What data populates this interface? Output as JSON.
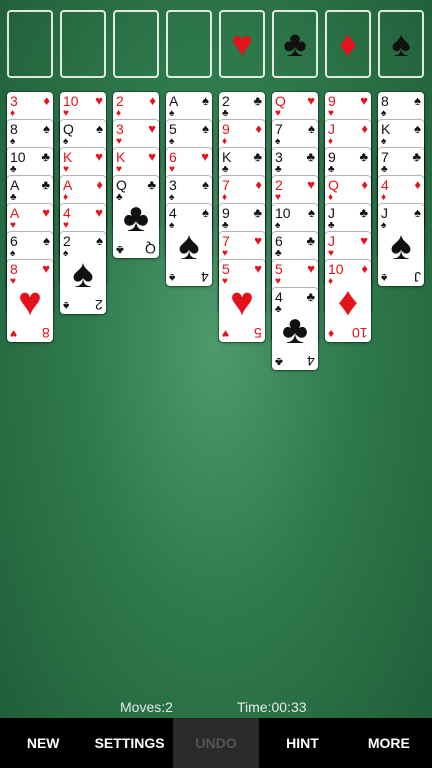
{
  "foundations": [
    {
      "suit": "",
      "color": "black"
    },
    {
      "suit": "",
      "color": "black"
    },
    {
      "suit": "",
      "color": "black"
    },
    {
      "suit": "",
      "color": "black"
    },
    {
      "suit": "♥",
      "color": "red"
    },
    {
      "suit": "♣",
      "color": "black"
    },
    {
      "suit": "♦",
      "color": "red"
    },
    {
      "suit": "♠",
      "color": "black"
    }
  ],
  "columns": [
    [
      [
        "3",
        "♦"
      ],
      [
        "8",
        "♠"
      ],
      [
        "10",
        "♣"
      ],
      [
        "A",
        "♣"
      ],
      [
        "A",
        "♥"
      ],
      [
        "6",
        "♠"
      ],
      [
        "8",
        "♥"
      ]
    ],
    [
      [
        "10",
        "♥"
      ],
      [
        "Q",
        "♠"
      ],
      [
        "K",
        "♥"
      ],
      [
        "A",
        "♦"
      ],
      [
        "4",
        "♥"
      ],
      [
        "2",
        "♠"
      ]
    ],
    [
      [
        "2",
        "♦"
      ],
      [
        "3",
        "♥"
      ],
      [
        "K",
        "♥"
      ],
      [
        "Q",
        "♣"
      ]
    ],
    [
      [
        "A",
        "♠"
      ],
      [
        "5",
        "♠"
      ],
      [
        "6",
        "♥"
      ],
      [
        "3",
        "♠"
      ],
      [
        "4",
        "♠"
      ]
    ],
    [
      [
        "2",
        "♣"
      ],
      [
        "9",
        "♦"
      ],
      [
        "K",
        "♣"
      ],
      [
        "7",
        "♦"
      ],
      [
        "9",
        "♣"
      ],
      [
        "7",
        "♥"
      ],
      [
        "5",
        "♥"
      ]
    ],
    [
      [
        "Q",
        "♥"
      ],
      [
        "7",
        "♠"
      ],
      [
        "3",
        "♣"
      ],
      [
        "2",
        "♥"
      ],
      [
        "10",
        "♠"
      ],
      [
        "6",
        "♣"
      ],
      [
        "5",
        "♥"
      ],
      [
        "4",
        "♣"
      ]
    ],
    [
      [
        "9",
        "♥"
      ],
      [
        "J",
        "♦"
      ],
      [
        "9",
        "♣"
      ],
      [
        "Q",
        "♦"
      ],
      [
        "J",
        "♣"
      ],
      [
        "J",
        "♥"
      ],
      [
        "10",
        "♦"
      ]
    ],
    [
      [
        "8",
        "♠"
      ],
      [
        "K",
        "♠"
      ],
      [
        "7",
        "♣"
      ],
      [
        "4",
        "♦"
      ],
      [
        "J",
        "♠"
      ]
    ]
  ],
  "status": {
    "moves_label": "Moves:",
    "moves": "2",
    "time_label": "Time:",
    "time": "00:33"
  },
  "toolbar": {
    "new": "NEW",
    "settings": "SETTINGS",
    "undo": "UNDO",
    "hint": "HINT",
    "more": "MORE"
  },
  "colors": {
    "felt": "#2f7a4c",
    "red_suit": "#e3121b",
    "black_suit": "#111111",
    "toolbar_bg": "#000000",
    "disabled_button_bg": "#2a2a2a"
  }
}
